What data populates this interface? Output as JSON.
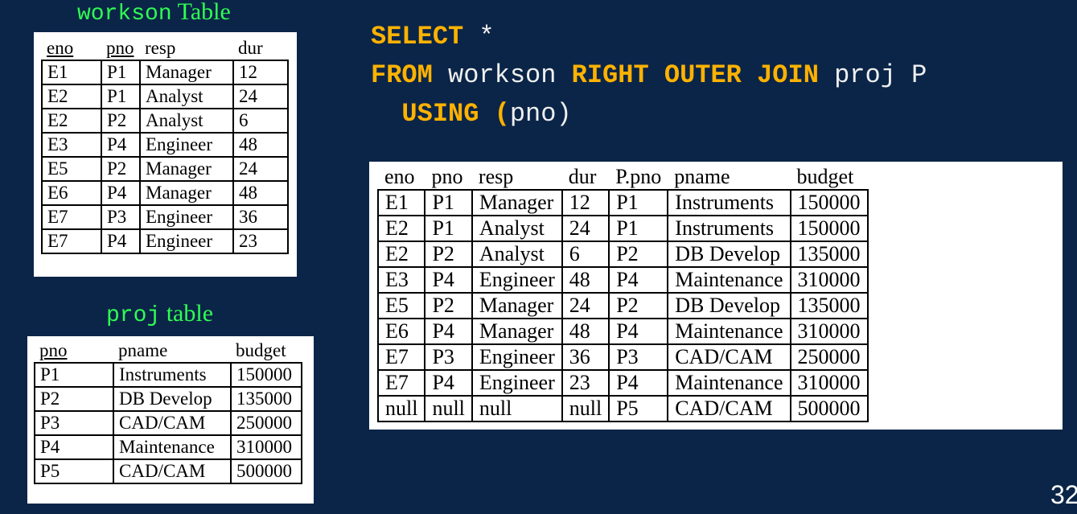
{
  "workson_caption": {
    "mono": "workson",
    "word": "Table"
  },
  "proj_caption": {
    "mono": "proj",
    "word": "table"
  },
  "sql": {
    "select_kw": "SELECT",
    "select_rest": " *",
    "from_kw": "FROM",
    "table1": " workson ",
    "join_kw": "RIGHT OUTER JOIN",
    "table2": " proj P",
    "using_kw": "USING",
    "paren_open": " (",
    "using_col": "pno",
    "paren_close": ")"
  },
  "workson": {
    "headers": [
      "eno",
      "pno",
      "resp",
      "dur"
    ],
    "rows": [
      [
        "E1",
        "P1",
        "Manager",
        "12"
      ],
      [
        "E2",
        "P1",
        "Analyst",
        "24"
      ],
      [
        "E2",
        "P2",
        "Analyst",
        "6"
      ],
      [
        "E3",
        "P4",
        "Engineer",
        "48"
      ],
      [
        "E5",
        "P2",
        "Manager",
        "24"
      ],
      [
        "E6",
        "P4",
        "Manager",
        "48"
      ],
      [
        "E7",
        "P3",
        "Engineer",
        "36"
      ],
      [
        "E7",
        "P4",
        "Engineer",
        "23"
      ]
    ]
  },
  "proj": {
    "headers": [
      "pno",
      "pname",
      "budget"
    ],
    "rows": [
      [
        "P1",
        "Instruments",
        "150000"
      ],
      [
        "P2",
        "DB Develop",
        "135000"
      ],
      [
        "P3",
        "CAD/CAM",
        "250000"
      ],
      [
        "P4",
        "Maintenance",
        "310000"
      ],
      [
        "P5",
        "CAD/CAM",
        "500000"
      ]
    ]
  },
  "result": {
    "headers": [
      "eno",
      "pno",
      "resp",
      "dur",
      "P.pno",
      "pname",
      "budget"
    ],
    "rows": [
      [
        "E1",
        "P1",
        "Manager",
        "12",
        "P1",
        "Instruments",
        "150000"
      ],
      [
        "E2",
        "P1",
        "Analyst",
        "24",
        "P1",
        "Instruments",
        "150000"
      ],
      [
        "E2",
        "P2",
        "Analyst",
        "6",
        "P2",
        "DB Develop",
        "135000"
      ],
      [
        "E3",
        "P4",
        "Engineer",
        "48",
        "P4",
        "Maintenance",
        "310000"
      ],
      [
        "E5",
        "P2",
        "Manager",
        "24",
        "P2",
        "DB Develop",
        "135000"
      ],
      [
        "E6",
        "P4",
        "Manager",
        "48",
        "P4",
        "Maintenance",
        "310000"
      ],
      [
        "E7",
        "P3",
        "Engineer",
        "36",
        "P3",
        "CAD/CAM",
        "250000"
      ],
      [
        "E7",
        "P4",
        "Engineer",
        "23",
        "P4",
        "Maintenance",
        "310000"
      ],
      [
        "null",
        "null",
        "null",
        "null",
        "P5",
        "CAD/CAM",
        "500000"
      ]
    ]
  },
  "page_number": "32"
}
